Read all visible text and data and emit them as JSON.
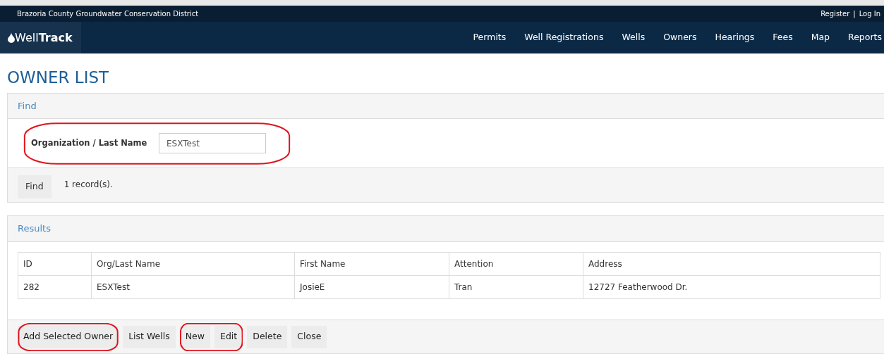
{
  "top_bar": {
    "organization": "Brazoria County Groundwater Conservation District",
    "links": [
      "Register",
      "Log In"
    ],
    "separator": "|"
  },
  "nav": {
    "logo": {
      "light": "Well",
      "bold": "Track"
    },
    "items": [
      "Permits",
      "Well Registrations",
      "Wells",
      "Owners",
      "Hearings",
      "Fees",
      "Map",
      "Reports"
    ]
  },
  "page_title": "OWNER LIST",
  "find_panel": {
    "title": "Find",
    "field": {
      "label": "Organization / Last Name",
      "value": "ESXTest",
      "highlighted": true
    },
    "button": "Find",
    "record_count": "1 record(s)."
  },
  "results_panel": {
    "title": "Results",
    "table": {
      "columns": [
        "ID",
        "Org/Last Name",
        "First Name",
        "Attention",
        "Address"
      ],
      "rows": [
        [
          "282",
          "ESXTest",
          "JosieE",
          "Tran",
          "12727 Featherwood Dr."
        ]
      ]
    },
    "button_groups": [
      {
        "highlighted": true,
        "buttons": [
          "Add Selected Owner"
        ]
      },
      {
        "highlighted": false,
        "buttons": [
          "List Wells"
        ]
      },
      {
        "highlighted": true,
        "buttons": [
          "New",
          "Edit"
        ]
      },
      {
        "highlighted": false,
        "buttons": [
          "Delete"
        ]
      },
      {
        "highlighted": false,
        "buttons": [
          "Close"
        ]
      }
    ]
  }
}
